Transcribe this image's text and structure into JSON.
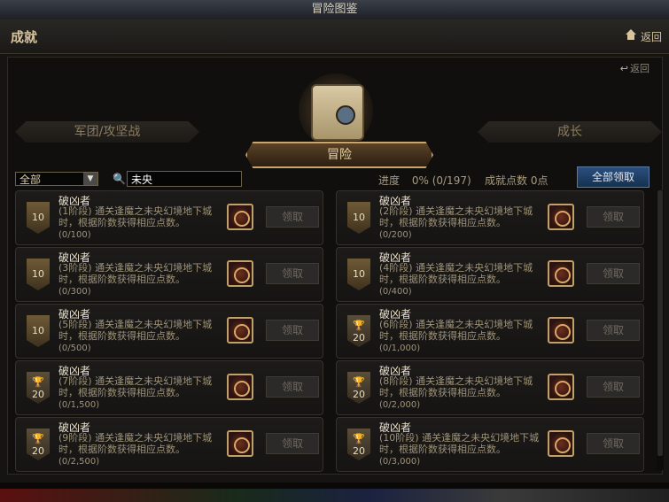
{
  "window": {
    "title": "冒险图鉴"
  },
  "header": {
    "title": "成就",
    "back_label": "返回"
  },
  "panel": {
    "back_label": "返回"
  },
  "categories": {
    "left": "军团/攻坚战",
    "center": "冒险",
    "right": "成长"
  },
  "filter": {
    "selected": "全部"
  },
  "search": {
    "value": "未央"
  },
  "stats": {
    "progress_label": "进度",
    "progress_value": "0% (0/197)",
    "points_label": "成就点数 0点"
  },
  "claim_all_label": "全部领取",
  "achievements": [
    {
      "name": "破凶者",
      "stage": "(1阶段)",
      "desc": "通关逢魔之未央幻境地下城时，根据阶数获得相应点数。",
      "progress": "(0/100)",
      "badge": "10",
      "badge_type": "plain",
      "claim_label": "领取"
    },
    {
      "name": "破凶者",
      "stage": "(2阶段)",
      "desc": "通关逢魔之未央幻境地下城时，根据阶数获得相应点数。",
      "progress": "(0/200)",
      "badge": "10",
      "badge_type": "plain",
      "claim_label": "领取"
    },
    {
      "name": "破凶者",
      "stage": "(3阶段)",
      "desc": "通关逢魔之未央幻境地下城时，根据阶数获得相应点数。",
      "progress": "(0/300)",
      "badge": "10",
      "badge_type": "plain",
      "claim_label": "领取"
    },
    {
      "name": "破凶者",
      "stage": "(4阶段)",
      "desc": "通关逢魔之未央幻境地下城时，根据阶数获得相应点数。",
      "progress": "(0/400)",
      "badge": "10",
      "badge_type": "plain",
      "claim_label": "领取"
    },
    {
      "name": "破凶者",
      "stage": "(5阶段)",
      "desc": "通关逢魔之未央幻境地下城时，根据阶数获得相应点数。",
      "progress": "(0/500)",
      "badge": "10",
      "badge_type": "plain",
      "claim_label": "领取"
    },
    {
      "name": "破凶者",
      "stage": "(6阶段)",
      "desc": "通关逢魔之未央幻境地下城时，根据阶数获得相应点数。",
      "progress": "(0/1,000)",
      "badge": "20",
      "badge_type": "trophy",
      "claim_label": "领取"
    },
    {
      "name": "破凶者",
      "stage": "(7阶段)",
      "desc": "通关逢魔之未央幻境地下城时，根据阶数获得相应点数。",
      "progress": "(0/1,500)",
      "badge": "20",
      "badge_type": "trophy",
      "claim_label": "领取"
    },
    {
      "name": "破凶者",
      "stage": "(8阶段)",
      "desc": "通关逢魔之未央幻境地下城时，根据阶数获得相应点数。",
      "progress": "(0/2,000)",
      "badge": "20",
      "badge_type": "trophy",
      "claim_label": "领取"
    },
    {
      "name": "破凶者",
      "stage": "(9阶段)",
      "desc": "通关逢魔之未央幻境地下城时，根据阶数获得相应点数。",
      "progress": "(0/2,500)",
      "badge": "20",
      "badge_type": "trophy",
      "claim_label": "领取"
    },
    {
      "name": "破凶者",
      "stage": "(10阶段)",
      "desc": "通关逢魔之未央幻境地下城时，根据阶数获得相应点数。",
      "progress": "(0/3,000)",
      "badge": "20",
      "badge_type": "trophy",
      "claim_label": "领取"
    }
  ]
}
